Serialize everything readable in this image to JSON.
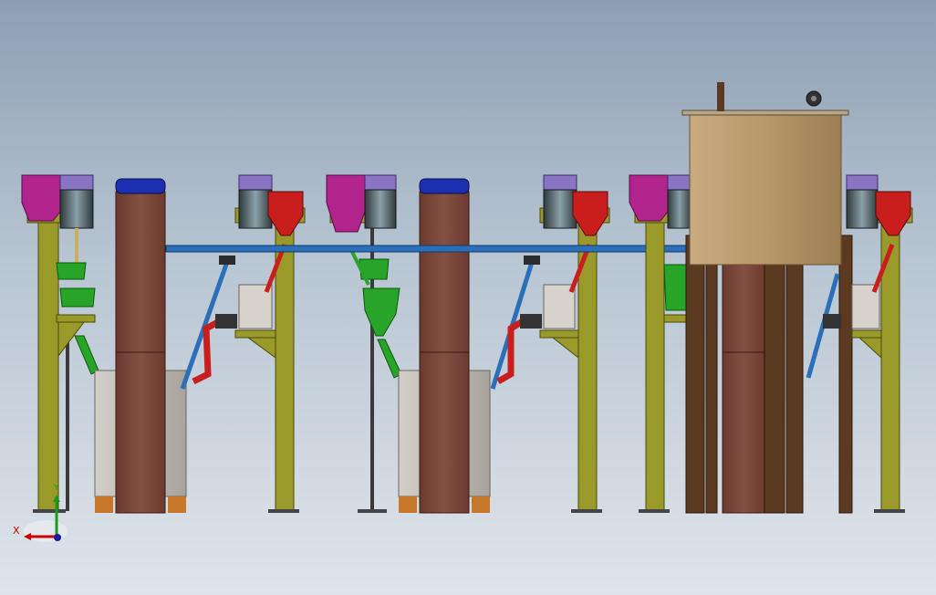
{
  "viewport": {
    "background_top": "#8c9fb4",
    "background_bottom": "#dfe4ea"
  },
  "triad": {
    "x_label": "X",
    "y_label": "Y",
    "x_color": "#cc0000",
    "y_color": "#1a9a1a",
    "z_color": "#1a1aa0"
  },
  "palette": {
    "frame": "#9a9a2a",
    "frame_dark": "#5e5e12",
    "motor": "#6f86a0",
    "motor_cap": "#8a74c4",
    "hopper_magenta": "#b0248c",
    "hopper_red": "#c81e1e",
    "hopper_green": "#28a428",
    "column": "#7a4538",
    "column_cap": "#1c2fb0",
    "pipe_blue": "#2b6fb8",
    "pipe_red": "#c81e1e",
    "tank": "#a88c62",
    "tank_post": "#5c3a22",
    "cabinet": "#c3bdb6",
    "orange_foot": "#c7772a"
  },
  "modules": [
    {
      "id": "module-1",
      "has_magenta_hopper": true,
      "has_column": true,
      "has_red_hopper": true
    },
    {
      "id": "module-2",
      "has_magenta_hopper": true,
      "has_column": true,
      "has_red_hopper": true
    },
    {
      "id": "module-3",
      "has_magenta_hopper": true,
      "has_column": false,
      "has_red_hopper": true,
      "has_tank": true
    }
  ]
}
